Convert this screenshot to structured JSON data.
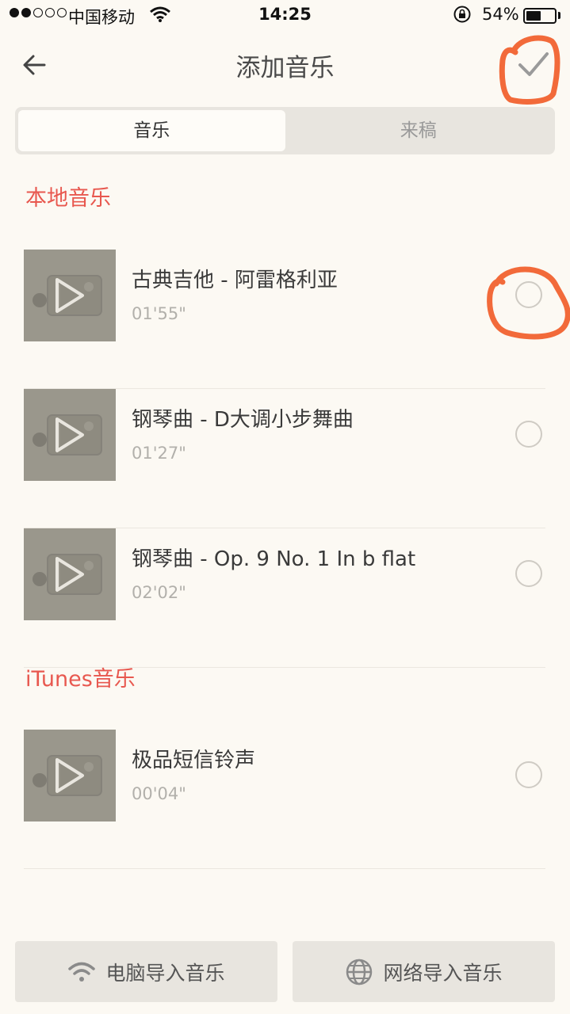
{
  "status_bar": {
    "carrier": "中国移动",
    "time": "14:25",
    "battery_percent": "54%",
    "battery_level": 0.54,
    "signal_bars_filled": 2,
    "signal_bars_total": 5
  },
  "nav": {
    "title": "添加音乐",
    "back_icon": "arrow-left-icon",
    "confirm_icon": "checkmark-icon"
  },
  "tabs": [
    {
      "label": "音乐",
      "active": true
    },
    {
      "label": "来稿",
      "active": false
    }
  ],
  "sections": [
    {
      "title": "本地音乐",
      "items": [
        {
          "title": "古典吉他 - 阿雷格利亚",
          "duration": "01'55\"",
          "selected": false
        },
        {
          "title": "钢琴曲 - D大调小步舞曲",
          "duration": "01'27\"",
          "selected": false
        },
        {
          "title": "钢琴曲 - Op. 9 No. 1 In b flat",
          "duration": "02'02\"",
          "selected": false
        }
      ]
    },
    {
      "title": "iTunes音乐",
      "items": [
        {
          "title": "极品短信铃声",
          "duration": "00'04\"",
          "selected": false
        }
      ]
    }
  ],
  "bottom_buttons": [
    {
      "label": "电脑导入音乐",
      "icon": "wifi-icon"
    },
    {
      "label": "网络导入音乐",
      "icon": "globe-icon"
    }
  ],
  "colors": {
    "accent": "#e8584f",
    "annotation": "#f26a3a",
    "background": "#fcf9f3",
    "segment_bg": "#e8e5df"
  }
}
